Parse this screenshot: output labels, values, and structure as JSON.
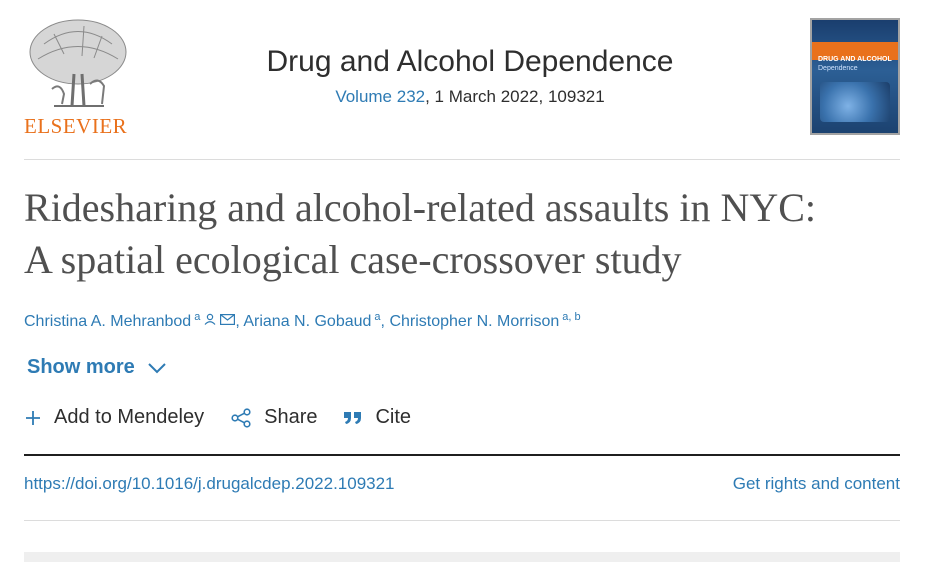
{
  "publisher": {
    "name": "ELSEVIER"
  },
  "journal": {
    "title": "Drug and Alcohol Dependence",
    "volume_link": "Volume 232",
    "issue_info": ", 1 March 2022, 109321"
  },
  "cover": {
    "title": "DRUG AND ALCOHOL",
    "subtitle": "Dependence"
  },
  "article": {
    "title_line1": "Ridesharing and alcohol-related assaults in NYC:",
    "title_line2": "A spatial ecological case-crossover study"
  },
  "authors": [
    {
      "name": "Christina A. Mehranbod",
      "affil": "a"
    },
    {
      "name": "Ariana N. Gobaud",
      "affil": "a"
    },
    {
      "name": "Christopher N. Morrison",
      "affil": "a, b"
    }
  ],
  "author_separator": ",",
  "show_more": "Show more",
  "actions": {
    "mendeley": "Add to Mendeley",
    "share": "Share",
    "cite": "Cite"
  },
  "doi": "https://doi.org/10.1016/j.drugalcdep.2022.109321",
  "rights": "Get rights and content",
  "colors": {
    "link": "#2e7bb4",
    "elsevier_orange": "#e9711c",
    "title_gray": "#505050"
  },
  "icons": [
    "elsevier-tree-logo",
    "person-icon",
    "envelope-icon",
    "chevron-down-icon",
    "plus-icon",
    "share-icon",
    "quote-icon"
  ]
}
